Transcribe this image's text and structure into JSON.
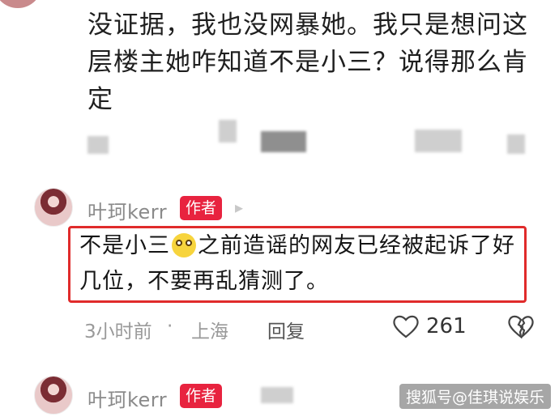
{
  "comment_above": {
    "text": "没证据，我也没网暴她。我只是想问这层楼主她咋知道不是小三？说得那么肯定"
  },
  "reply1": {
    "username": "叶珂kerr",
    "badge": "作者",
    "text_before_emoji": "不是小三",
    "emoji": "smile-emoji",
    "text_after_emoji": "之前造谣的网友已经被起诉了好几位，不要再乱猜测了。",
    "time": "3小时前",
    "location": "上海",
    "reply_label": "回复",
    "like_count": "261"
  },
  "reply2": {
    "username": "叶珂kerr",
    "badge": "作者"
  },
  "watermark": "搜狐号@佳琪说娱乐",
  "colors": {
    "badge": "#e8233f",
    "highlight_border": "#e02b2b"
  }
}
